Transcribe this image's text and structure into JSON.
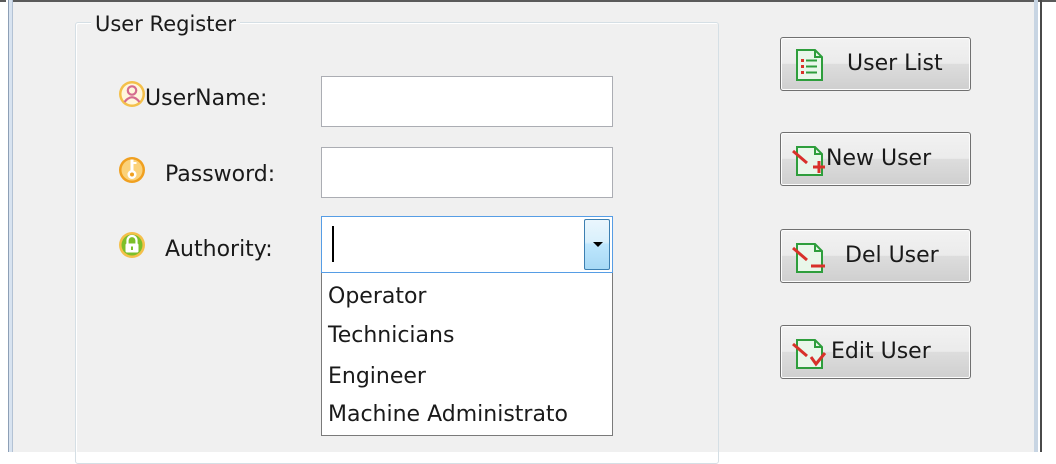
{
  "group": {
    "title": "User Register"
  },
  "form": {
    "username_label": "UserName:",
    "username_value": "",
    "password_label": "Password:",
    "password_value": "",
    "authority_label": "Authority:",
    "authority_value": "",
    "authority_options": [
      "Operator",
      "Technicians",
      "Engineer",
      "Machine Administrato"
    ]
  },
  "buttons": {
    "user_list": "User List",
    "new_user": "New User",
    "del_user": "Del User",
    "edit_user": "Edit User"
  },
  "icons": {
    "username": "user-icon",
    "password": "key-icon",
    "authority": "lock-icon",
    "user_list": "list-document-icon",
    "new_user": "add-document-icon",
    "del_user": "remove-document-icon",
    "edit_user": "edit-document-icon"
  },
  "colors": {
    "dialog_background": "#f0f0f0",
    "focus_border": "#569de5",
    "icon_green": "#2e9e3c",
    "icon_red": "#d8322a",
    "user_icon_pink": "#d46b8f",
    "key_icon_orange": "#f0a020",
    "lock_icon_green": "#7cbf2a"
  }
}
